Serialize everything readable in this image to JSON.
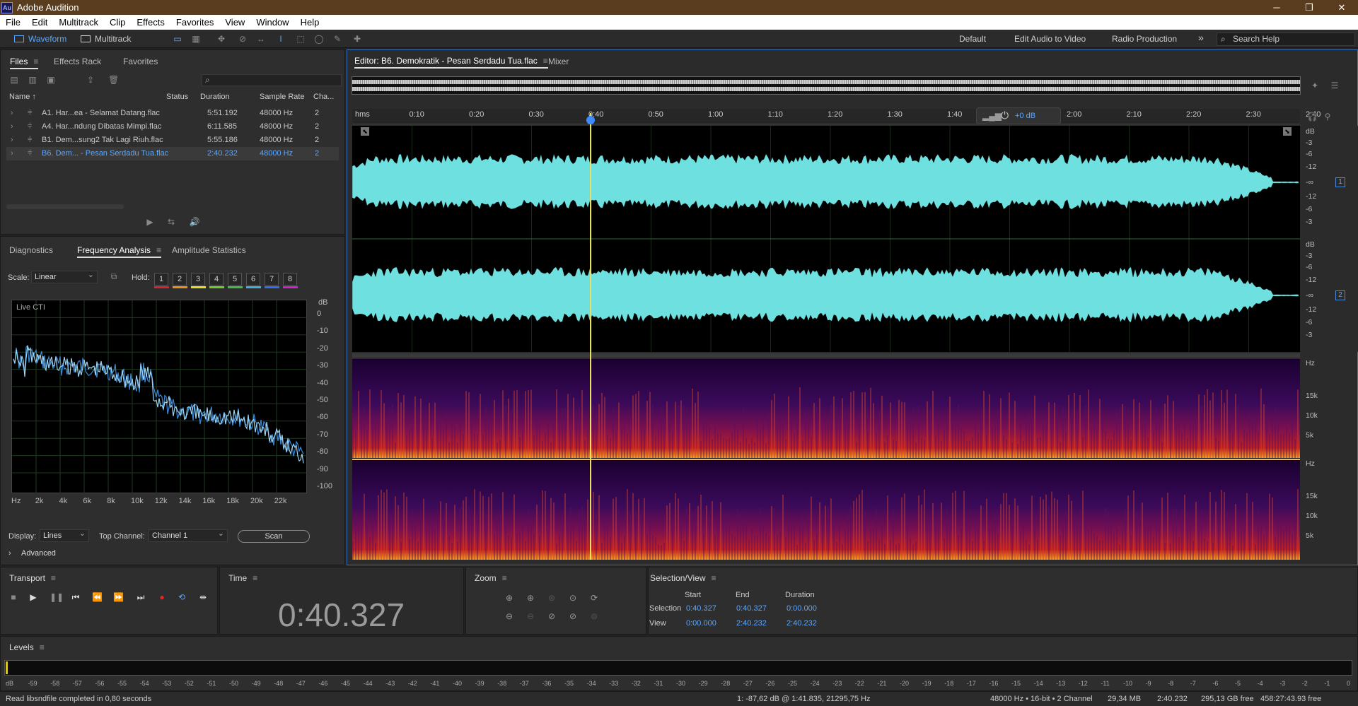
{
  "app": {
    "title": "Adobe Audition",
    "logo": "Au"
  },
  "window_controls": [
    "minimize-icon",
    "restore-icon",
    "close-icon"
  ],
  "menu": [
    "File",
    "Edit",
    "Multitrack",
    "Clip",
    "Effects",
    "Favorites",
    "View",
    "Window",
    "Help"
  ],
  "toolbar": {
    "modes": [
      "Waveform",
      "Multitrack"
    ],
    "workspaces": [
      "Default",
      "Edit Audio to Video",
      "Radio Production"
    ],
    "more": "»",
    "search_placeholder": "Search Help"
  },
  "files_panel": {
    "tabs": [
      "Files",
      "Effects Rack",
      "Favorites"
    ],
    "columns": [
      "Name ↑",
      "Status",
      "Duration",
      "Sample Rate",
      "Cha..."
    ],
    "rows": [
      {
        "name": "A1. Har...ea - Selamat Datang.flac",
        "duration": "5:51.192",
        "rate": "48000 Hz",
        "ch": "2"
      },
      {
        "name": "A4. Har...ndung Dibatas Mimpi.flac",
        "duration": "6:11.585",
        "rate": "48000 Hz",
        "ch": "2"
      },
      {
        "name": "B1. Dem...sung2 Tak Lagi Riuh.flac",
        "duration": "5:55.186",
        "rate": "48000 Hz",
        "ch": "2"
      },
      {
        "name": "B6. Dem... - Pesan Serdadu Tua.flac",
        "duration": "2:40.232",
        "rate": "48000 Hz",
        "ch": "2"
      }
    ]
  },
  "analysis_panel": {
    "tabs": [
      "Diagnostics",
      "Frequency Analysis",
      "Amplitude Statistics"
    ],
    "scale_label": "Scale:",
    "scale_value": "Linear",
    "hold_label": "Hold:",
    "holds": [
      "1",
      "2",
      "3",
      "4",
      "5",
      "6",
      "7",
      "8"
    ],
    "hold_colors": [
      "#e0202a",
      "#f0901a",
      "#e8e020",
      "#70d020",
      "#40c040",
      "#40b0e0",
      "#3070f0",
      "#d020d0"
    ],
    "live_label": "Live CTI",
    "db_unit": "dB",
    "db_ticks": [
      "0",
      "-10",
      "-20",
      "-30",
      "-40",
      "-50",
      "-60",
      "-70",
      "-80",
      "-90",
      "-100"
    ],
    "hz_ticks": [
      "Hz",
      "2k",
      "4k",
      "6k",
      "8k",
      "10k",
      "12k",
      "14k",
      "16k",
      "18k",
      "20k",
      "22k"
    ],
    "display_label": "Display:",
    "display_value": "Lines",
    "top_channel_label": "Top Channel:",
    "top_channel_value": "Channel 1",
    "scan_label": "Scan",
    "advanced_label": "Advanced"
  },
  "editor": {
    "tab_label": "Editor: B6. Demokratik - Pesan Serdadu Tua.flac",
    "mixer_label": "Mixer",
    "timeline": [
      "hms",
      "0:10",
      "0:20",
      "0:30",
      "0:40",
      "0:50",
      "1:00",
      "1:10",
      "1:20",
      "1:30",
      "1:40",
      "1:50",
      "2:00",
      "2:10",
      "2:20",
      "2:30",
      "2:40"
    ],
    "gain": "+0 dB",
    "db_scale_top": [
      "dB",
      "-3",
      "-6",
      "-12",
      "-∞",
      "-12",
      "-6",
      "-3"
    ],
    "db_scale_bottom": [
      "dB",
      "-3",
      "-6",
      "-12",
      "-∞",
      "-12",
      "-6",
      "-3"
    ],
    "channel_badges": [
      "1",
      "2"
    ],
    "hz_scale": [
      "Hz",
      "15k",
      "10k",
      "5k"
    ]
  },
  "transport": {
    "title": "Transport"
  },
  "time": {
    "title": "Time",
    "value": "0:40.327"
  },
  "zoom": {
    "title": "Zoom"
  },
  "selection_view": {
    "title": "Selection/View",
    "headers": [
      "Start",
      "End",
      "Duration"
    ],
    "selection_label": "Selection",
    "selection": [
      "0:40.327",
      "0:40.327",
      "0:00.000"
    ],
    "view_label": "View",
    "view": [
      "0:00.000",
      "2:40.232",
      "2:40.232"
    ]
  },
  "levels": {
    "title": "Levels",
    "ticks": [
      "dB",
      "-59",
      "-58",
      "-57",
      "-56",
      "-55",
      "-54",
      "-53",
      "-52",
      "-51",
      "-50",
      "-49",
      "-48",
      "-47",
      "-46",
      "-45",
      "-44",
      "-43",
      "-42",
      "-41",
      "-40",
      "-39",
      "-38",
      "-37",
      "-36",
      "-35",
      "-34",
      "-33",
      "-32",
      "-31",
      "-30",
      "-29",
      "-28",
      "-27",
      "-26",
      "-25",
      "-24",
      "-23",
      "-22",
      "-21",
      "-20",
      "-19",
      "-18",
      "-17",
      "-16",
      "-15",
      "-14",
      "-13",
      "-12",
      "-11",
      "-10",
      "-9",
      "-8",
      "-7",
      "-6",
      "-5",
      "-4",
      "-3",
      "-2",
      "-1",
      "0"
    ]
  },
  "status": {
    "message": "Read libsndfile completed in 0,80 seconds",
    "cursor": "1: -87,62 dB @ 1:41.835, 21295,75 Hz",
    "format": "48000 Hz • 16-bit • 2 Channel",
    "size": "29,34 MB",
    "duration": "2:40.232",
    "free": "295,13 GB free",
    "free_time": "458:27:43.93 free"
  },
  "colors": {
    "accent": "#5aa7ff",
    "waveform": "#6fe0e0",
    "playhead": "#e8e060"
  }
}
